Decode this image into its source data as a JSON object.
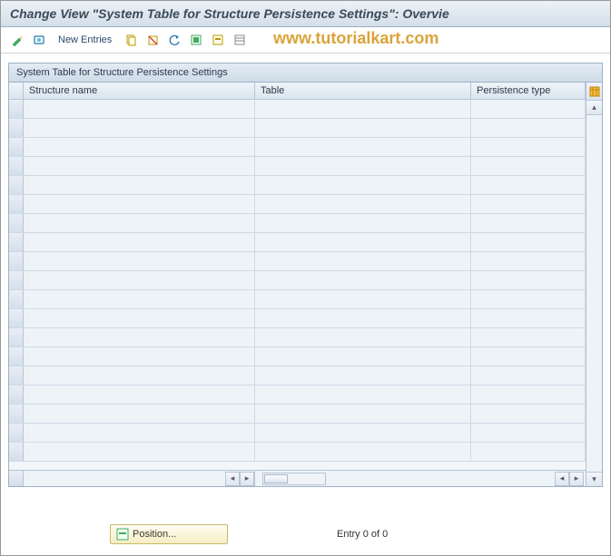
{
  "title": "Change View \"System Table for Structure Persistence Settings\": Overvie",
  "toolbar": {
    "new_entries": "New Entries"
  },
  "watermark": "www.tutorialkart.com",
  "panel": {
    "title": "System Table for Structure Persistence Settings",
    "columns": [
      "Structure name",
      "Table",
      "Persistence type"
    ],
    "row_count": 19
  },
  "footer": {
    "position_label": "Position...",
    "entry_text": "Entry 0 of 0"
  }
}
